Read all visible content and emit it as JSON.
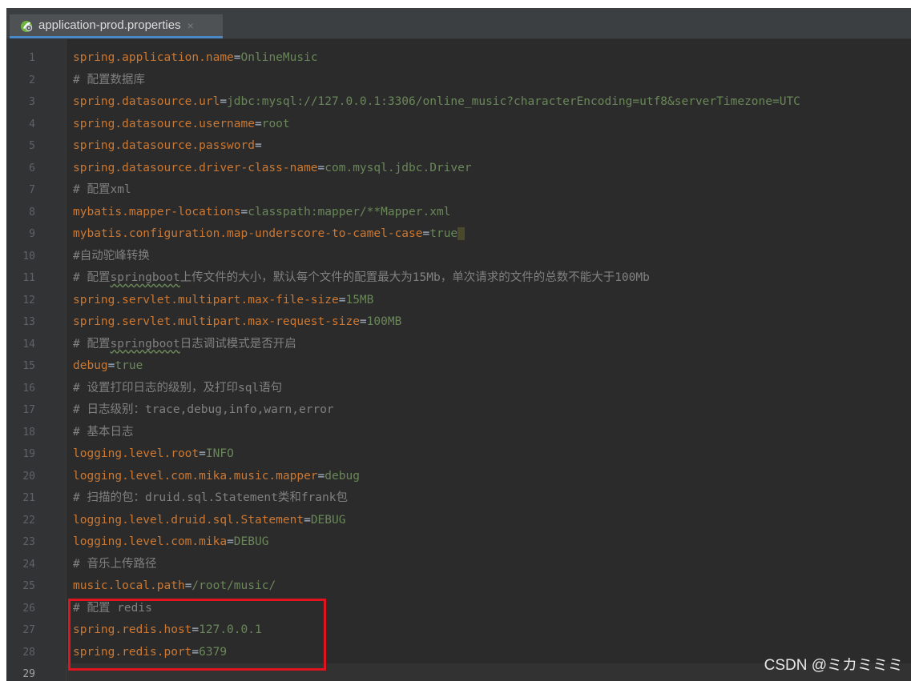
{
  "tab": {
    "title": "application-prod.properties",
    "close": "×",
    "icon": "spring-properties-icon"
  },
  "lines": [
    {
      "n": "1",
      "parts": [
        {
          "t": "spring.application.name",
          "c": "k"
        },
        {
          "t": "=",
          "c": "eq"
        },
        {
          "t": "OnlineMusic",
          "c": "v"
        }
      ]
    },
    {
      "n": "2",
      "parts": [
        {
          "t": "# 配置数据库",
          "c": "c"
        }
      ]
    },
    {
      "n": "3",
      "parts": [
        {
          "t": "spring.datasource.url",
          "c": "k"
        },
        {
          "t": "=",
          "c": "eq"
        },
        {
          "t": "jdbc:mysql://127.0.0.1:3306/online_music?characterEncoding=utf8&serverTimezone=UTC",
          "c": "v"
        }
      ]
    },
    {
      "n": "4",
      "parts": [
        {
          "t": "spring.datasource.username",
          "c": "k"
        },
        {
          "t": "=",
          "c": "eq"
        },
        {
          "t": "root",
          "c": "v"
        }
      ]
    },
    {
      "n": "5",
      "parts": [
        {
          "t": "spring.datasource.password",
          "c": "k"
        },
        {
          "t": "=",
          "c": "eq"
        }
      ]
    },
    {
      "n": "6",
      "parts": [
        {
          "t": "spring.datasource.driver-class-name",
          "c": "k"
        },
        {
          "t": "=",
          "c": "eq"
        },
        {
          "t": "com.mysql.jdbc.Driver",
          "c": "v"
        }
      ]
    },
    {
      "n": "7",
      "parts": [
        {
          "t": "# 配置xml",
          "c": "c"
        }
      ]
    },
    {
      "n": "8",
      "parts": [
        {
          "t": "mybatis.mapper-locations",
          "c": "k"
        },
        {
          "t": "=",
          "c": "eq"
        },
        {
          "t": "classpath:mapper/**Mapper.xml",
          "c": "v"
        }
      ]
    },
    {
      "n": "9",
      "parts": [
        {
          "t": "mybatis.configuration.map-underscore-to-camel-case",
          "c": "k"
        },
        {
          "t": "=",
          "c": "eq"
        },
        {
          "t": "true",
          "c": "v"
        },
        {
          "t": " ",
          "c": "caret-hl"
        }
      ]
    },
    {
      "n": "10",
      "parts": [
        {
          "t": "#自动驼峰转换",
          "c": "c"
        }
      ]
    },
    {
      "n": "11",
      "parts": [
        {
          "t": "# 配置",
          "c": "c"
        },
        {
          "t": "springboot",
          "c": "c squiggle"
        },
        {
          "t": "上传文件的大小，默认每个文件的配置最大为15Mb，单次请求的文件的总数不能大于100Mb",
          "c": "c"
        }
      ]
    },
    {
      "n": "12",
      "parts": [
        {
          "t": "spring.servlet.multipart.max-file-size",
          "c": "k"
        },
        {
          "t": "=",
          "c": "eq"
        },
        {
          "t": "15MB",
          "c": "v"
        }
      ]
    },
    {
      "n": "13",
      "parts": [
        {
          "t": "spring.servlet.multipart.max-request-size",
          "c": "k"
        },
        {
          "t": "=",
          "c": "eq"
        },
        {
          "t": "100MB",
          "c": "v"
        }
      ]
    },
    {
      "n": "14",
      "parts": [
        {
          "t": "# 配置",
          "c": "c"
        },
        {
          "t": "springboot",
          "c": "c squiggle"
        },
        {
          "t": "日志调试模式是否开启",
          "c": "c"
        }
      ]
    },
    {
      "n": "15",
      "parts": [
        {
          "t": "debug",
          "c": "k"
        },
        {
          "t": "=",
          "c": "eq"
        },
        {
          "t": "true",
          "c": "v"
        }
      ]
    },
    {
      "n": "16",
      "parts": [
        {
          "t": "# 设置打印日志的级别，及打印sql语句",
          "c": "c"
        }
      ]
    },
    {
      "n": "17",
      "parts": [
        {
          "t": "# 日志级别：trace,debug,info,warn,error",
          "c": "c"
        }
      ]
    },
    {
      "n": "18",
      "parts": [
        {
          "t": "# 基本日志",
          "c": "c"
        }
      ]
    },
    {
      "n": "19",
      "parts": [
        {
          "t": "logging.level.root",
          "c": "k"
        },
        {
          "t": "=",
          "c": "eq"
        },
        {
          "t": "INFO",
          "c": "v"
        }
      ]
    },
    {
      "n": "20",
      "parts": [
        {
          "t": "logging.level.com.mika.music.mapper",
          "c": "k"
        },
        {
          "t": "=",
          "c": "eq"
        },
        {
          "t": "debug",
          "c": "v"
        }
      ]
    },
    {
      "n": "21",
      "parts": [
        {
          "t": "# 扫描的包：druid.sql.Statement类和frank包",
          "c": "c"
        }
      ]
    },
    {
      "n": "22",
      "parts": [
        {
          "t": "logging.level.druid.sql.Statement",
          "c": "k"
        },
        {
          "t": "=",
          "c": "eq"
        },
        {
          "t": "DEBUG",
          "c": "v"
        }
      ]
    },
    {
      "n": "23",
      "parts": [
        {
          "t": "logging.level.com.mika",
          "c": "k"
        },
        {
          "t": "=",
          "c": "eq"
        },
        {
          "t": "DEBUG",
          "c": "v"
        }
      ]
    },
    {
      "n": "24",
      "parts": [
        {
          "t": "# 音乐上传路径",
          "c": "c"
        }
      ]
    },
    {
      "n": "25",
      "parts": [
        {
          "t": "music.local.path",
          "c": "k"
        },
        {
          "t": "=",
          "c": "eq"
        },
        {
          "t": "/root/music/",
          "c": "v"
        }
      ]
    },
    {
      "n": "26",
      "parts": [
        {
          "t": "# 配置 redis",
          "c": "c"
        }
      ]
    },
    {
      "n": "27",
      "parts": [
        {
          "t": "spring.redis.host",
          "c": "k"
        },
        {
          "t": "=",
          "c": "eq"
        },
        {
          "t": "127.0.0.1",
          "c": "v"
        }
      ]
    },
    {
      "n": "28",
      "parts": [
        {
          "t": "spring.redis.port",
          "c": "k"
        },
        {
          "t": "=",
          "c": "eq"
        },
        {
          "t": "6379",
          "c": "v"
        }
      ]
    },
    {
      "n": "29",
      "parts": []
    }
  ],
  "current_line": "29",
  "watermark": "CSDN @ミカミミミ",
  "colors": {
    "key": "#cc7832",
    "value": "#6a8759",
    "comment": "#808080",
    "annotation_box": "#e0141e"
  }
}
